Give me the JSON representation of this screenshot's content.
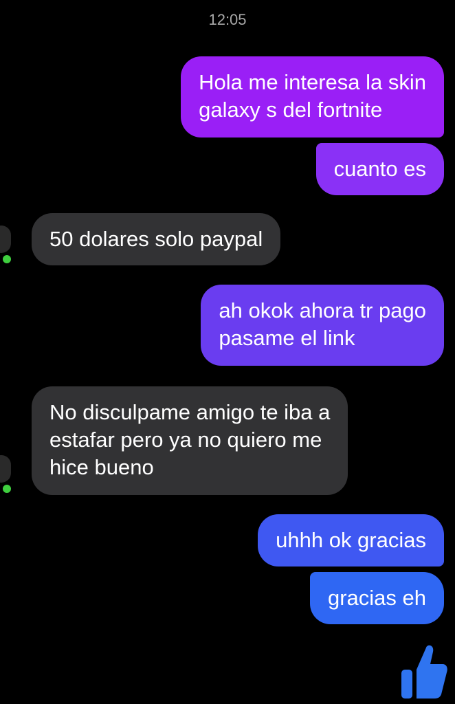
{
  "chat": {
    "timestamp": "12:05",
    "messages": [
      {
        "from": "me",
        "text": "Hola me interesa la skin\ngalaxy s del fortnite"
      },
      {
        "from": "me",
        "text": "cuanto es"
      },
      {
        "from": "other",
        "text": "50 dolares solo paypal"
      },
      {
        "from": "me",
        "text": "ah okok ahora tr pago\npasame el link"
      },
      {
        "from": "other",
        "text": "No disculpame amigo te iba a\nestafar pero ya no quiero me\nhice bueno"
      },
      {
        "from": "me",
        "text": "uhhh ok gracias"
      },
      {
        "from": "me",
        "text": "gracias eh"
      }
    ],
    "like_icon": "thumbs-up-icon",
    "colors": {
      "background": "#000000",
      "incoming_bubble": "#323234",
      "outgoing_gradient": [
        "#9a1ff6",
        "#6a3df0",
        "#2f67f3"
      ],
      "online_indicator": "#3fcf3f",
      "like_button": "#2f74f0"
    }
  }
}
